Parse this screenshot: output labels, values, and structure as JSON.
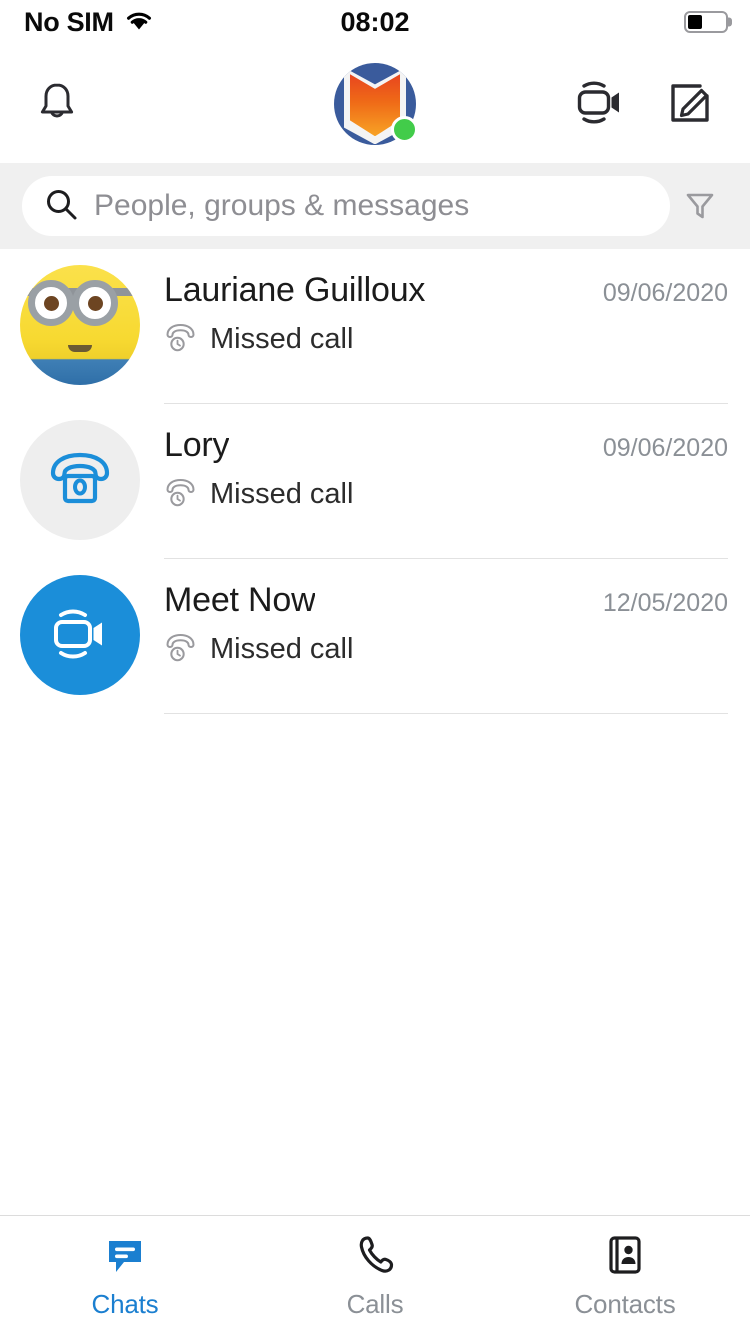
{
  "status_bar": {
    "carrier": "No SIM",
    "time": "08:02",
    "wifi_icon": "wifi-icon",
    "battery_icon": "battery-icon",
    "battery_level_percent": 40
  },
  "header": {
    "notifications_icon": "bell-icon",
    "profile_avatar": "profile-avatar",
    "presence": "online",
    "presence_color": "#42cc4a",
    "meet_now_icon": "video-camera-icon",
    "new_chat_icon": "compose-pencil-icon"
  },
  "search": {
    "placeholder": "People, groups & messages",
    "value": "",
    "search_icon": "search-icon",
    "filter_icon": "filter-funnel-icon"
  },
  "conversations": [
    {
      "name": "Lauriane Guilloux",
      "preview": "Missed call",
      "preview_icon": "missed-call-icon",
      "date": "09/06/2020",
      "avatar_type": "photo-minion"
    },
    {
      "name": "Lory",
      "preview": "Missed call",
      "preview_icon": "missed-call-icon",
      "date": "09/06/2020",
      "avatar_type": "desk-phone-icon"
    },
    {
      "name": "Meet Now",
      "preview": "Missed call",
      "preview_icon": "missed-call-icon",
      "date": "12/05/2020",
      "avatar_type": "video-camera-icon"
    }
  ],
  "tabs": [
    {
      "label": "Chats",
      "icon": "chat-bubble-icon",
      "active": true
    },
    {
      "label": "Calls",
      "icon": "phone-handset-icon",
      "active": false
    },
    {
      "label": "Contacts",
      "icon": "contact-book-icon",
      "active": false
    }
  ],
  "colors": {
    "accent_blue": "#1b8ed9",
    "tab_active_blue": "#1b7fd0",
    "muted_gray": "#8b9096",
    "search_band": "#f0f0f0"
  }
}
